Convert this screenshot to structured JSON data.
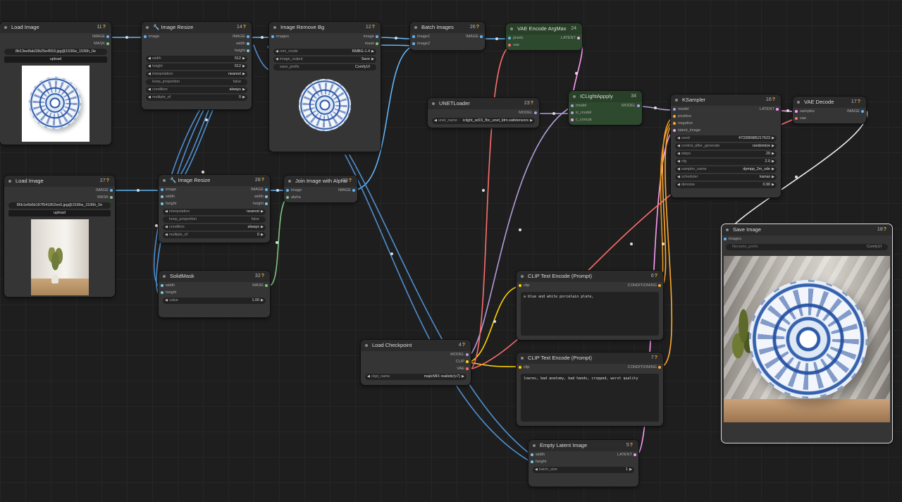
{
  "colors": {
    "image": "#64b5f6",
    "mask": "#81c784",
    "latent": "#ff9cf9",
    "model": "#b39ddb",
    "clip": "#ffd500",
    "vae": "#ff6e6e",
    "conditioning": "#ffa931",
    "int": "#7ec8e3"
  },
  "nodes": {
    "load_image_1": {
      "title": "Load Image",
      "id": "11",
      "outputs": [
        "IMAGE",
        "MASK"
      ],
      "filename": "8b13ee8ab33b25e4553.jpg@1536w_1536h_0e",
      "upload": "upload"
    },
    "resize_1": {
      "title": "🔧 Image Resize",
      "id": "14",
      "input": "image",
      "outputs": [
        "IMAGE",
        "width",
        "height"
      ],
      "widgets": [
        [
          "width",
          "512"
        ],
        [
          "height",
          "512"
        ],
        [
          "interpolation",
          "nearest"
        ],
        [
          "keep_proportion",
          "false"
        ],
        [
          "condition",
          "always"
        ],
        [
          "multiple_of",
          "0"
        ]
      ]
    },
    "remove_bg": {
      "title": "Image Remove Bg",
      "id": "12",
      "input": "images",
      "outputs": [
        "image",
        "mask"
      ],
      "widgets": [
        [
          "rem_mode",
          "RMBG-1.4"
        ],
        [
          "image_output",
          "Save"
        ],
        [
          "save_prefix",
          "ComfyUI"
        ]
      ]
    },
    "batch_images": {
      "title": "Batch Images",
      "id": "26",
      "inputs": [
        "image1",
        "image2"
      ],
      "output": "IMAGE"
    },
    "vae_encode": {
      "title": "VAE Encode ArgMax",
      "id": "24",
      "inputs": [
        "pixels",
        "vae"
      ],
      "output": "LATENT"
    },
    "unet_loader": {
      "title": "UNETLoader",
      "id": "23",
      "output": "MODEL",
      "widget": [
        "unet_name",
        "iclight_sd15_fbc_unet_ldm.safetensors"
      ]
    },
    "iclight": {
      "title": "ICLightAppply",
      "id": "34",
      "inputs": [
        "model",
        "ic_model",
        "c_concat"
      ],
      "output": "MODEL"
    },
    "ksampler": {
      "title": "KSampler",
      "id": "16",
      "inputs": [
        "model",
        "positive",
        "negative",
        "latent_image"
      ],
      "output": "LATENT",
      "widgets": [
        [
          "seed",
          "473396985217623"
        ],
        [
          "control_after_generate",
          "randomize"
        ],
        [
          "steps",
          "20"
        ],
        [
          "cfg",
          "2.0"
        ],
        [
          "sampler_name",
          "dpmpp_2m_sde"
        ],
        [
          "scheduler",
          "karras"
        ],
        [
          "denoise",
          "0.90"
        ]
      ]
    },
    "vae_decode": {
      "title": "VAE Decode",
      "id": "17",
      "inputs": [
        "samples",
        "vae"
      ],
      "output": "IMAGE"
    },
    "load_image_2": {
      "title": "Load Image",
      "id": "27",
      "outputs": [
        "IMAGE",
        "MASK"
      ],
      "filename": "86b1e6b6b187f541852ee5.jpg@1536w_1536h_0e",
      "upload": "upload"
    },
    "resize_2": {
      "title": "🔧 Image Resize",
      "id": "28",
      "inputs": [
        "image",
        "width",
        "height"
      ],
      "outputs": [
        "IMAGE",
        "width",
        "height"
      ],
      "widgets": [
        [
          "interpolation",
          "nearest"
        ],
        [
          "keep_proportion",
          "false"
        ],
        [
          "condition",
          "always"
        ],
        [
          "multiple_of",
          "0"
        ]
      ]
    },
    "join_alpha": {
      "title": "Join Image with Alpha",
      "id": "33",
      "inputs": [
        "image",
        "alpha"
      ],
      "output": "IMAGE"
    },
    "solid_mask": {
      "title": "SolidMask",
      "id": "32",
      "inputs": [
        "width",
        "height"
      ],
      "output": "MASK",
      "widget": [
        "value",
        "1.00"
      ]
    },
    "clip_pos": {
      "title": "CLIP Text Encode (Prompt)",
      "id": "6",
      "input": "clip",
      "output": "CONDITIONING",
      "text": "a blue and white porcelain plate,"
    },
    "clip_neg": {
      "title": "CLIP Text Encode (Prompt)",
      "id": "7",
      "input": "clip",
      "output": "CONDITIONING",
      "text": "lowres, bad anatomy, bad hands, cropped, worst quality"
    },
    "checkpoint": {
      "title": "Load Checkpoint",
      "id": "4",
      "outputs": [
        "MODEL",
        "CLIP",
        "VAE"
      ],
      "widget": [
        "ckpt_name",
        "majicMIX realistic(v7)"
      ]
    },
    "empty_latent": {
      "title": "Empty Latent Image",
      "id": "5",
      "inputs": [
        "width",
        "height"
      ],
      "output": "LATENT",
      "widget": [
        "batch_size",
        "1"
      ]
    },
    "save_image": {
      "title": "Save Image",
      "id": "18",
      "input": "images",
      "widget": [
        "filename_prefix",
        "ComfyUI"
      ]
    }
  }
}
